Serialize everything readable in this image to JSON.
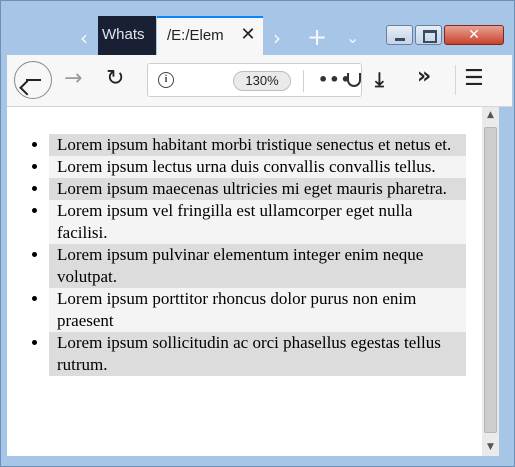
{
  "window": {
    "tabs": [
      {
        "title": "Whats",
        "active": false
      },
      {
        "title": "/E:/Elem",
        "active": true,
        "close_glyph": "✕"
      }
    ],
    "tab_back_glyph": "‹",
    "tab_forward_glyph": "›",
    "new_tab_glyph": "+",
    "tab_list_glyph": "⌄",
    "close_glyph": "✕"
  },
  "toolbar": {
    "forward_glyph": "→",
    "reload_glyph": "↻",
    "zoom": "130%",
    "page_actions_glyph": "•••",
    "download_glyph": "⤓",
    "overflow_glyph": "»",
    "menu_glyph": "☰",
    "info_glyph": "i"
  },
  "list_items": [
    "Lorem ipsum habitant morbi tristique senectus et netus et.",
    "Lorem ipsum lectus urna duis convallis convallis tellus.",
    "Lorem ipsum maecenas ultricies mi eget mauris pharetra.",
    "Lorem ipsum vel fringilla est ullamcorper eget nulla facilisi.",
    "Lorem ipsum pulvinar elementum integer enim neque volutpat.",
    "Lorem ipsum porttitor rhoncus dolor purus non enim praesent",
    "Lorem ipsum sollicitudin ac orci phasellus egestas tellus rutrum."
  ],
  "scrollbar": {
    "up_glyph": "▲",
    "down_glyph": "▼",
    "grip_glyph": "≡"
  },
  "colors": {
    "row_odd": "#dcdcdc",
    "row_even": "#f4f4f4",
    "frame": "#a7c5e6",
    "tab_active_accent": "#0a84ff"
  }
}
